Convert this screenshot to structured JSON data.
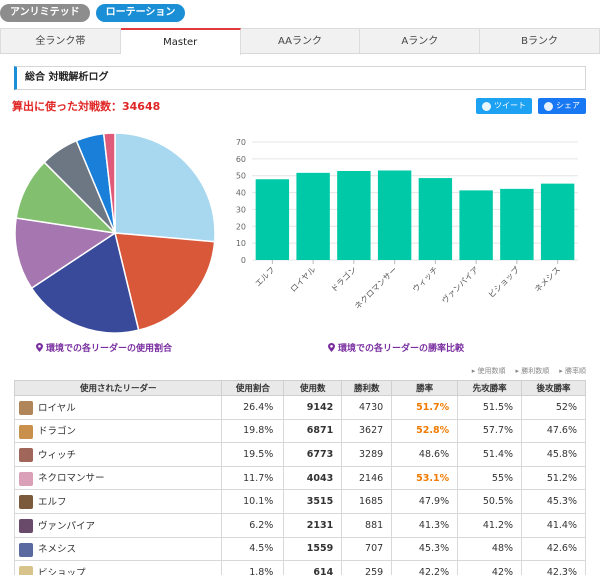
{
  "mode_buttons": [
    "アンリミテッド",
    "ローテーション"
  ],
  "tabs": [
    {
      "label": "全ランク帯",
      "active": false
    },
    {
      "label": "Master",
      "active": true
    },
    {
      "label": "AAランク",
      "active": false
    },
    {
      "label": "Aランク",
      "active": false
    },
    {
      "label": "Bランク",
      "active": false
    }
  ],
  "section_title": "総合 対戦解析ログ",
  "battle_count": "算出に使った対戦数：34648",
  "share": {
    "tweet": "ツイート",
    "facebook": "シェア"
  },
  "captions": {
    "pie": "環境での各リーダーの使用割合",
    "bar": "環境での各リーダーの勝率比較"
  },
  "sort_links": [
    "使用数順",
    "勝利数順",
    "勝率順"
  ],
  "colors": {
    "bar": "#00c9a7",
    "highlight": "#f07b00",
    "count": "#e02626",
    "caption": "#7a2fa0"
  },
  "chart_data": [
    {
      "type": "pie",
      "labels": [
        "ロイヤル",
        "ドラゴン",
        "ウィッチ",
        "ネクロマンサー",
        "エルフ",
        "ヴァンパイア",
        "ネメシス",
        "ビショップ"
      ],
      "values": [
        26.4,
        19.8,
        19.5,
        11.7,
        10.1,
        6.2,
        4.5,
        1.8
      ],
      "colors": [
        "#a8d8f0",
        "#d9583a",
        "#3a4a9a",
        "#a676b0",
        "#82c070",
        "#6d7683",
        "#1a7fd8",
        "#e05a7a"
      ]
    },
    {
      "type": "bar",
      "categories": [
        "エルフ",
        "ロイヤル",
        "ドラゴン",
        "ネクロマンサー",
        "ウィッチ",
        "ヴァンパイア",
        "ビショップ",
        "ネメシス"
      ],
      "values": [
        47.9,
        51.7,
        52.8,
        53.1,
        48.6,
        41.3,
        42.2,
        45.3
      ],
      "ylim": [
        0,
        70
      ],
      "yticks": [
        0,
        10,
        20,
        30,
        40,
        50,
        60,
        70
      ],
      "grid": true
    }
  ],
  "table": {
    "headers": [
      "使用されたリーダー",
      "使用割合",
      "使用数",
      "勝利数",
      "勝率",
      "先攻勝率",
      "後攻勝率"
    ],
    "rows": [
      {
        "name": "ロイヤル",
        "share": "26.4%",
        "used": "9142",
        "wins": "4730",
        "rate": "51.7%",
        "first": "51.5%",
        "second": "52%",
        "hl": true,
        "face": "#b0855a"
      },
      {
        "name": "ドラゴン",
        "share": "19.8%",
        "used": "6871",
        "wins": "3627",
        "rate": "52.8%",
        "first": "57.7%",
        "second": "47.6%",
        "hl": true,
        "face": "#c9904c"
      },
      {
        "name": "ウィッチ",
        "share": "19.5%",
        "used": "6773",
        "wins": "3289",
        "rate": "48.6%",
        "first": "51.4%",
        "second": "45.8%",
        "hl": false,
        "face": "#a0665a"
      },
      {
        "name": "ネクロマンサー",
        "share": "11.7%",
        "used": "4043",
        "wins": "2146",
        "rate": "53.1%",
        "first": "55%",
        "second": "51.2%",
        "hl": true,
        "face": "#d9a0b8"
      },
      {
        "name": "エルフ",
        "share": "10.1%",
        "used": "3515",
        "wins": "1685",
        "rate": "47.9%",
        "first": "50.5%",
        "second": "45.3%",
        "hl": false,
        "face": "#7a5a3a"
      },
      {
        "name": "ヴァンパイア",
        "share": "6.2%",
        "used": "2131",
        "wins": "881",
        "rate": "41.3%",
        "first": "41.2%",
        "second": "41.4%",
        "hl": false,
        "face": "#6a4a6a"
      },
      {
        "name": "ネメシス",
        "share": "4.5%",
        "used": "1559",
        "wins": "707",
        "rate": "45.3%",
        "first": "48%",
        "second": "42.6%",
        "hl": false,
        "face": "#5a6aa0"
      },
      {
        "name": "ビショップ",
        "share": "1.8%",
        "used": "614",
        "wins": "259",
        "rate": "42.2%",
        "first": "42%",
        "second": "42.3%",
        "hl": false,
        "face": "#d8c48a"
      }
    ]
  }
}
